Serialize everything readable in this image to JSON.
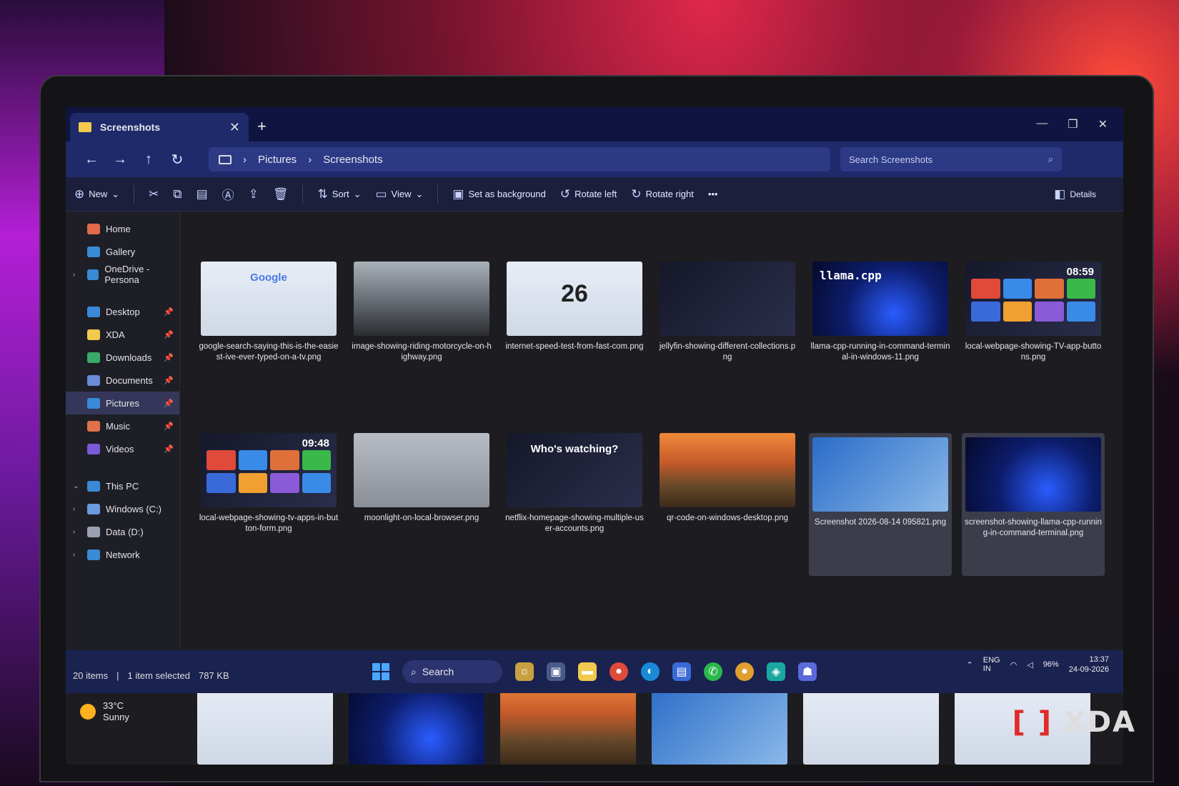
{
  "window": {
    "tab_title": "Screenshots",
    "tab_close": "✕",
    "new_tab": "+",
    "controls": [
      "—",
      "❐",
      "✕"
    ]
  },
  "address": {
    "crumbs": [
      "Pictures",
      "Screenshots"
    ],
    "separator": "›",
    "search_placeholder": "Search Screenshots"
  },
  "commands": {
    "new": "New",
    "sort": "Sort",
    "view": "View",
    "set_background": "Set as background",
    "rotate_left": "Rotate left",
    "rotate_right": "Rotate right",
    "more": "•••",
    "details": "Details"
  },
  "sidebar": {
    "top": [
      {
        "label": "Home",
        "color": "#e06a4a"
      },
      {
        "label": "Gallery",
        "color": "#3a8ad8"
      },
      {
        "label": "OneDrive - Persona",
        "color": "#3a8ad8"
      }
    ],
    "quick": [
      {
        "label": "Desktop",
        "color": "#3a8ad8"
      },
      {
        "label": "XDA",
        "color": "#f2c94c"
      },
      {
        "label": "Downloads",
        "color": "#3aaa6a"
      },
      {
        "label": "Documents",
        "color": "#6a8ad8"
      },
      {
        "label": "Pictures",
        "color": "#3a8ad8"
      },
      {
        "label": "Music",
        "color": "#e0704a"
      },
      {
        "label": "Videos",
        "color": "#7a5ad8"
      }
    ],
    "pc": [
      {
        "label": "This PC",
        "color": "#3a8ad8"
      },
      {
        "label": "Windows (C:)",
        "color": "#6a9ae0"
      },
      {
        "label": "Data (D:)",
        "color": "#9aa0b0"
      },
      {
        "label": "Network",
        "color": "#3a8ad8"
      }
    ]
  },
  "files": [
    {
      "name": "google-search-saying-this-is-the-easiest-ive-ever-typed-on-a-tv.png",
      "style": "t-light",
      "overlay": "Google"
    },
    {
      "name": "image-showing-riding-motorcycle-on-highway.png",
      "style": "t-road",
      "overlay": ""
    },
    {
      "name": "internet-speed-test-from-fast-com.png",
      "style": "t-light",
      "overlay": "26"
    },
    {
      "name": "jellyfin-showing-different-collections.png",
      "style": "t-dark",
      "overlay": ""
    },
    {
      "name": "llama-cpp-running-in-command-terminal-in-windows-11.png",
      "style": "t-win",
      "overlay": "llama.cpp"
    },
    {
      "name": "local-webpage-showing-TV-app-buttons.png",
      "style": "t-dark",
      "overlay": "08:59"
    },
    {
      "name": "local-webpage-showing-tv-apps-in-button-form.png",
      "style": "t-dark",
      "overlay": "09:48"
    },
    {
      "name": "moonlight-on-local-browser.png",
      "style": "t-gray",
      "overlay": ""
    },
    {
      "name": "netflix-homepage-showing-multiple-user-accounts.png",
      "style": "t-dark",
      "overlay": "Who's watching?"
    },
    {
      "name": "qr-code-on-windows-desktop.png",
      "style": "t-sunset",
      "overlay": ""
    },
    {
      "name": "Screenshot 2026-08-14 095821.png",
      "style": "t-blue",
      "overlay": ""
    },
    {
      "name": "screenshot-showing-llama-cpp-running-in-command-terminal.png",
      "style": "t-win",
      "overlay": ""
    }
  ],
  "status": {
    "items": "20 items",
    "selected": "1 item selected",
    "size": "787 KB"
  },
  "taskbar": {
    "search": "Search",
    "lang": "ENG",
    "region": "IN",
    "battery": "96%",
    "time": "13:37",
    "date": "24-09-2026"
  },
  "weather": {
    "temp": "33°C",
    "cond": "Sunny"
  },
  "watermark": "XDA"
}
